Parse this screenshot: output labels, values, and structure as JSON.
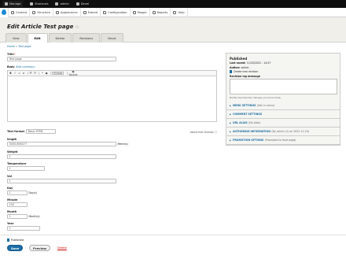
{
  "toolbar_top": {
    "items": [
      {
        "label": "Manage",
        "icon": "menu-icon"
      },
      {
        "label": "Shortcuts",
        "icon": "star-icon"
      },
      {
        "label": "admin",
        "icon": "user-icon"
      },
      {
        "label": "Devel",
        "icon": "gear-icon"
      }
    ]
  },
  "toolbar_admin": {
    "items": [
      {
        "label": "Content",
        "icon": "content-icon"
      },
      {
        "label": "Structure",
        "icon": "structure-icon"
      },
      {
        "label": "Appearance",
        "icon": "appearance-icon"
      },
      {
        "label": "Extend",
        "icon": "extend-icon"
      },
      {
        "label": "Configuration",
        "icon": "wrench-icon"
      },
      {
        "label": "People",
        "icon": "people-icon"
      },
      {
        "label": "Reports",
        "icon": "reports-icon"
      },
      {
        "label": "Help",
        "icon": "help-icon"
      }
    ]
  },
  "page": {
    "title": "Edit Article Test page",
    "star": "☆"
  },
  "tabs": [
    "View",
    "Edit",
    "Delete",
    "Revisions",
    "Devel"
  ],
  "active_tab": "Edit",
  "breadcrumb": "Home » Test page",
  "form": {
    "title_label": "Title",
    "title_required": "*",
    "title_value": "Test page",
    "body_label": "Body",
    "body_summary_link": "(Edit summary)",
    "editor_buttons": [
      "B",
      "I",
      "∞",
      "⊘",
      "☰",
      "☷",
      "❝",
      "▣",
      "‹›"
    ],
    "format_select": "Format",
    "source_button": "▣ Source",
    "text_format_label": "Text format",
    "text_format_value": "Basic HTML",
    "text_format_help": "About text formats ⓘ",
    "length_label": "length",
    "length_value": "3000.656377",
    "length_suffix": "Metre(s)",
    "weight_label": "Weight",
    "weight_value": "1",
    "temperature_label": "Temperature",
    "temperature_value": "1",
    "vol_label": "Vol",
    "vol_value": "1",
    "day_label": "Day",
    "day_value": "1",
    "day_suffix": "Day(s)",
    "minute_label": "Minute",
    "minute_value": "100",
    "month_label": "Month",
    "month_value": "1",
    "month_suffix": "Month(s)",
    "year_label": "Year",
    "year_value": "1",
    "published_label": "Published"
  },
  "sidebar": {
    "heading": "Published",
    "last_saved_label": "Last saved:",
    "last_saved_value": "11/20/2022 - 14:47",
    "author_label": "Author:",
    "author_value": "admin",
    "new_revision_label": "Create new revision",
    "revision_log_label": "Revision log message",
    "revision_log_help": "Briefly describe the changes you have made.",
    "sections": [
      {
        "title": "MENU SETTINGS",
        "summary": "(Not in menu)"
      },
      {
        "title": "COMMENT SETTINGS",
        "summary": ""
      },
      {
        "title": "URL ALIAS",
        "summary": "(No alias)"
      },
      {
        "title": "AUTHORING INFORMATION",
        "summary": "(By admin (1) on 2022-11-20)"
      },
      {
        "title": "PROMOTION OPTIONS",
        "summary": "(Promoted to front page)"
      }
    ]
  },
  "actions": {
    "save": "Save",
    "preview": "Preview",
    "delete": "Delete"
  },
  "colors": {
    "accent": "#1c6ea4",
    "toolbar_dark": "#0f0f0f",
    "header_bg": "#f0efe9",
    "delete": "#cc0000"
  }
}
